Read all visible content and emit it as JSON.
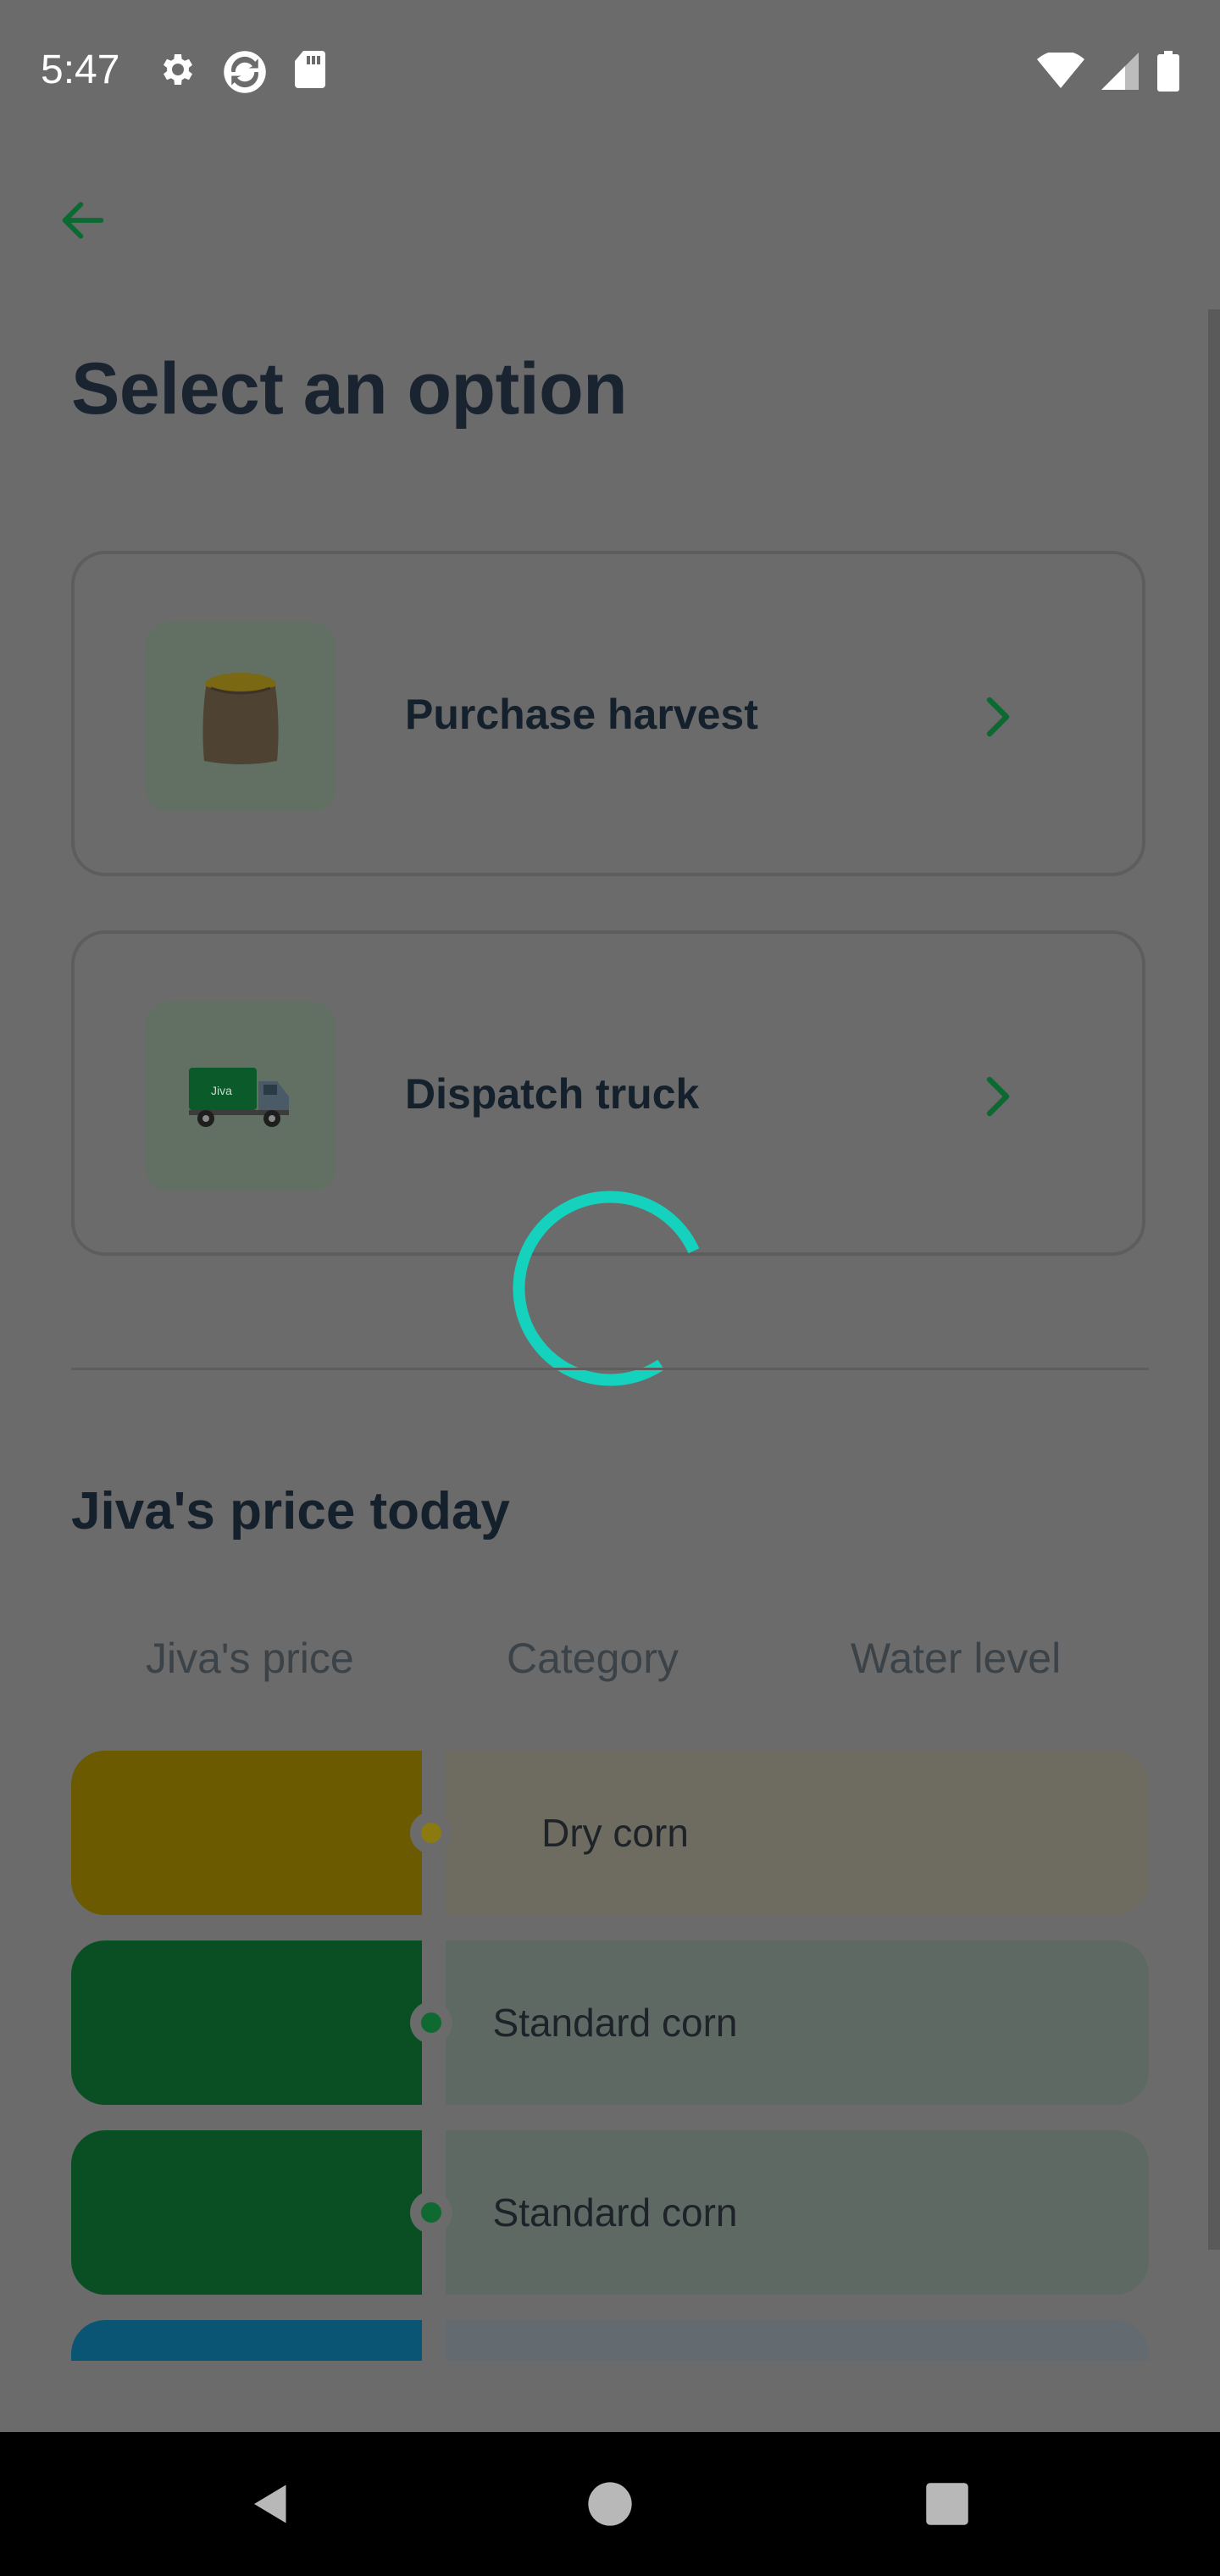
{
  "status_bar": {
    "time": "5:47",
    "left_icons": [
      "gear-icon",
      "sync-icon",
      "sd-card-icon"
    ],
    "right_icons": [
      "wifi-icon",
      "cell-signal-icon",
      "battery-icon"
    ]
  },
  "header": {
    "back_icon": "arrow-left-icon",
    "title": "Select an option"
  },
  "options": [
    {
      "label": "Purchase harvest",
      "icon": "harvest-sack-icon"
    },
    {
      "label": "Dispatch truck",
      "icon": "truck-icon",
      "truck_text": "Jiva"
    }
  ],
  "loading": true,
  "price_section": {
    "title": "Jiva's price today",
    "columns": [
      "Jiva's price",
      "Category",
      "Water level"
    ],
    "rows": [
      {
        "category": "Dry corn",
        "color": "#6b5a00",
        "panel_color": "#6e6b60",
        "dot_color": "#8a7a10"
      },
      {
        "category": "Standard corn",
        "color": "#0a4f24",
        "panel_color": "#5f6964",
        "dot_color": "#0e6a30"
      },
      {
        "category": "Standard corn",
        "color": "#0a4f24",
        "panel_color": "#5f6964",
        "dot_color": "#0e6a30"
      },
      {
        "category": "",
        "color": "#0a5574",
        "panel_color": "#636b70",
        "dot_color": "#0a5574"
      }
    ]
  },
  "colors": {
    "accent_green": "#0b6a32",
    "spinner": "#14d2be"
  },
  "nav_bar": {
    "buttons": [
      "back-triangle-icon",
      "home-circle-icon",
      "recents-square-icon"
    ]
  }
}
